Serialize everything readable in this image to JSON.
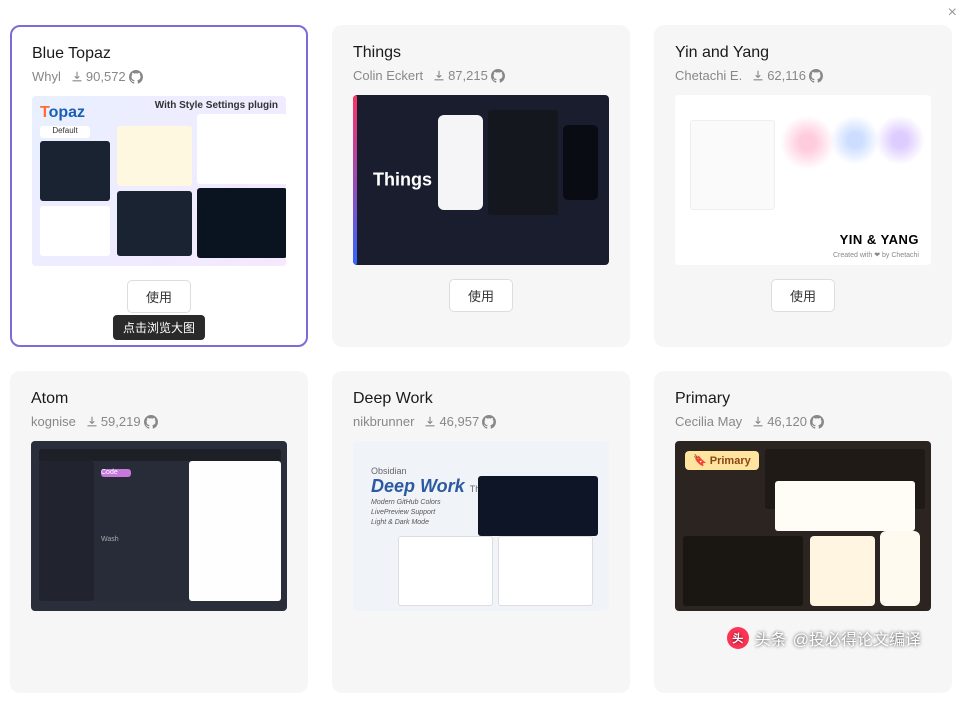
{
  "close_label": "×",
  "tooltip_text": "点击浏览大图",
  "use_button_label": "使用",
  "themes": [
    {
      "title": "Blue Topaz",
      "author": "Whyl",
      "downloads": "90,572",
      "selected": true,
      "preview_class": "topaz"
    },
    {
      "title": "Things",
      "author": "Colin Eckert",
      "downloads": "87,215",
      "selected": false,
      "preview_class": "things"
    },
    {
      "title": "Yin and Yang",
      "author": "Chetachi E.",
      "downloads": "62,116",
      "selected": false,
      "preview_class": "yinyang"
    },
    {
      "title": "Atom",
      "author": "kognise",
      "downloads": "59,219",
      "selected": false,
      "preview_class": "atom"
    },
    {
      "title": "Deep Work",
      "author": "nikbrunner",
      "downloads": "46,957",
      "selected": false,
      "preview_class": "deepwork"
    },
    {
      "title": "Primary",
      "author": "Cecilia May",
      "downloads": "46,120",
      "selected": false,
      "preview_class": "primary"
    }
  ],
  "preview_text": {
    "topaz_logo_prefix": "T",
    "topaz_logo_rest": "opaz",
    "topaz_default": "Default",
    "topaz_settings": "With Style Settings plugin",
    "things_label": "Things",
    "yinyang_label": "YIN & YANG",
    "yinyang_sub": "Created with ❤ by Chetachi",
    "deepwork_obsidian": "Obsidian",
    "deepwork_main": "Deep Work",
    "deepwork_theme": "Theme",
    "deepwork_feat1": "Modern GitHub Colors",
    "deepwork_feat2": "LivePreview Support",
    "deepwork_feat3": "Light & Dark Mode",
    "primary_badge": "🔖 Primary",
    "atom_code": "Code",
    "atom_wash": "Wash"
  },
  "watermark": {
    "icon_text": "头",
    "label": "头条",
    "handle": "@投必得论文编译"
  }
}
